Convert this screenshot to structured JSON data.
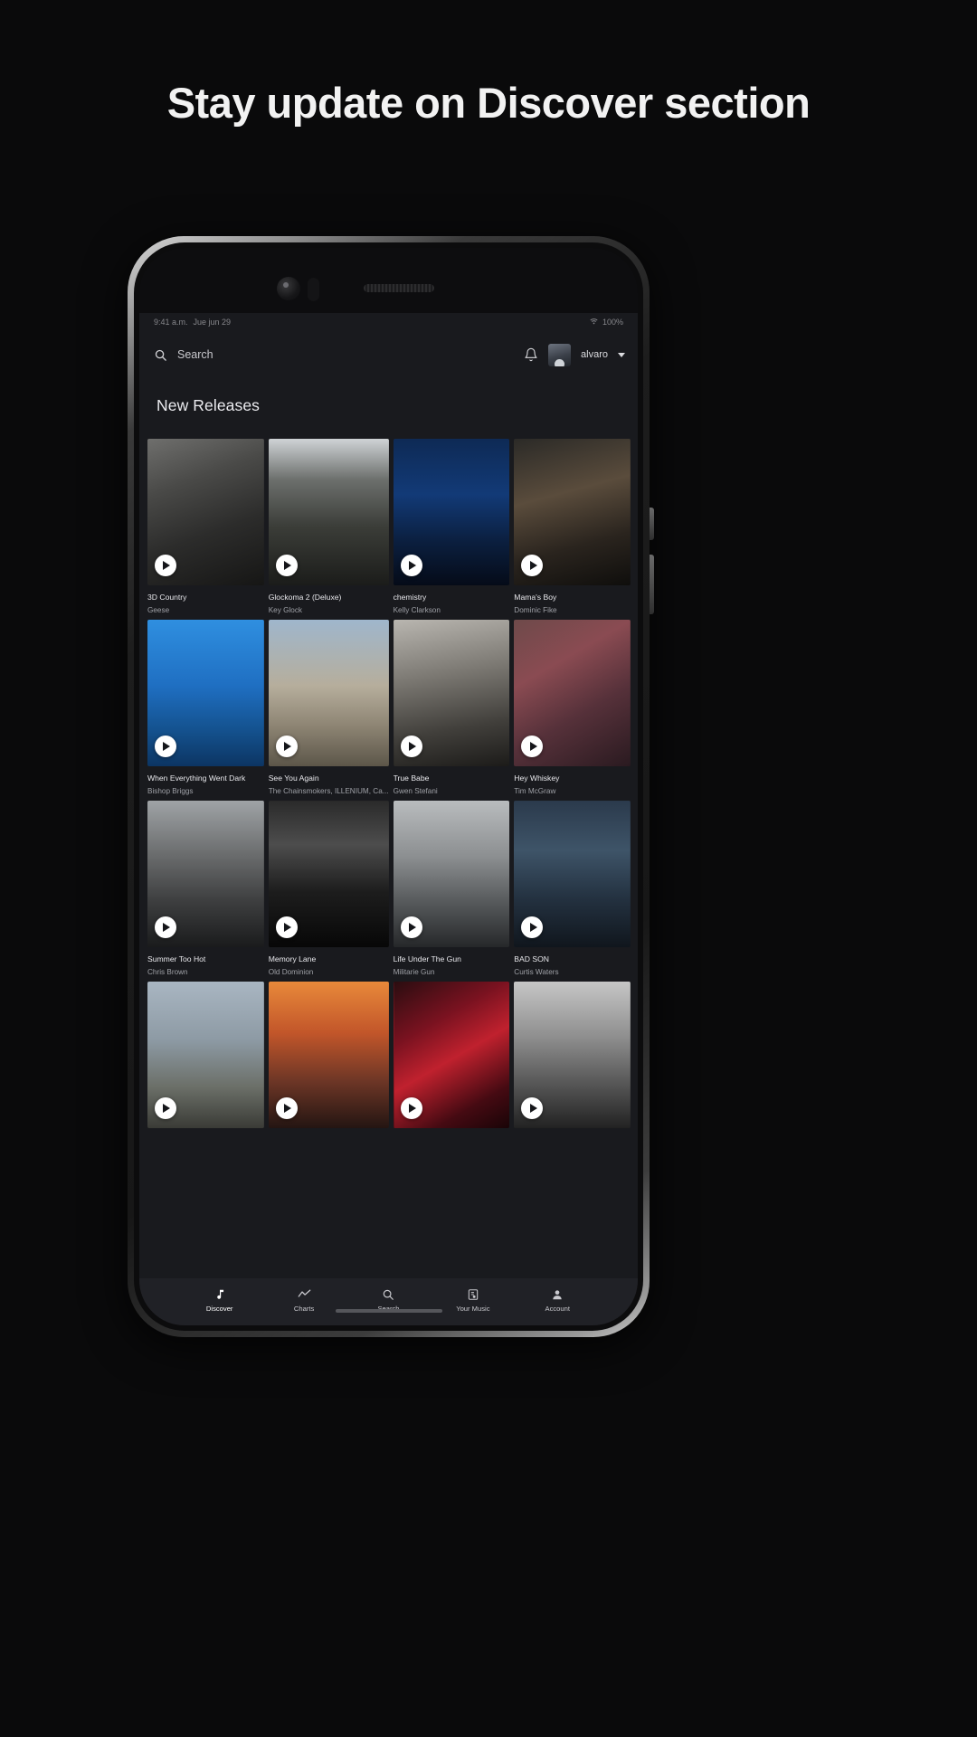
{
  "promo": {
    "headline": "Stay update on Discover section"
  },
  "phone": {
    "statusbar": {
      "time": "9:41 a.m.",
      "date": "Jue jun 29",
      "wifi": "wifi-icon",
      "battery": "100%"
    },
    "header": {
      "search_icon": "search-icon",
      "search_value": "",
      "search_placeholder": "Search",
      "bell_icon": "bell-icon",
      "avatar": "user-avatar",
      "username": "alvaro",
      "caret_icon": "chevron-down-icon"
    },
    "section": {
      "title": "New Releases"
    },
    "albums": [
      {
        "title": "3D Country",
        "artist": "Geese",
        "art": "grey-stone-building-bw"
      },
      {
        "title": "Glockoma 2 (Deluxe)",
        "artist": "Key Glock",
        "art": "tree-lined-street-bw"
      },
      {
        "title": "chemistry",
        "artist": "Kelly Clarkson",
        "art": "blue-night-harbour"
      },
      {
        "title": "Mama's Boy",
        "artist": "Dominic Fike",
        "art": "dark-alley-bench"
      },
      {
        "title": "When Everything Went Dark",
        "artist": "Bishop Briggs",
        "art": "blue-sky-tower"
      },
      {
        "title": "See You Again",
        "artist": "The Chainsmokers, ILLENIUM, Ca...",
        "art": "stone-arch-monument"
      },
      {
        "title": "True Babe",
        "artist": "Gwen Stefani",
        "art": "wooden-barrel-bw"
      },
      {
        "title": "Hey Whiskey",
        "artist": "Tim McGraw",
        "art": "red-mossy-rock"
      },
      {
        "title": "Summer Too Hot",
        "artist": "Chris Brown",
        "art": "terrace-chairs-bw"
      },
      {
        "title": "Memory Lane",
        "artist": "Old Dominion",
        "art": "dark-archway-bw"
      },
      {
        "title": "Life Under The Gun",
        "artist": "Militarie Gun",
        "art": "vintage-van-street"
      },
      {
        "title": "BAD SON",
        "artist": "Curtis Waters",
        "art": "city-street-night"
      },
      {
        "title": "",
        "artist": "",
        "art": "desert-road-clouds"
      },
      {
        "title": "",
        "artist": "",
        "art": "sunset-canal-city"
      },
      {
        "title": "",
        "artist": "",
        "art": "hot-panda-neon-sign"
      },
      {
        "title": "",
        "artist": "",
        "art": "empty-plaza-bw"
      }
    ],
    "bottom_nav": [
      {
        "label": "Discover",
        "icon": "music-note-icon",
        "active": true
      },
      {
        "label": "Charts",
        "icon": "trending-icon",
        "active": false
      },
      {
        "label": "Search",
        "icon": "search-icon",
        "active": false
      },
      {
        "label": "Your Music",
        "icon": "library-icon",
        "active": false
      },
      {
        "label": "Account",
        "icon": "person-icon",
        "active": false
      }
    ]
  },
  "colors": {
    "background": "#0a0a0b",
    "app_surface": "#191a1e",
    "nav_surface": "#202126",
    "text_primary": "#e8e8ec",
    "text_secondary": "#9ea0a6"
  }
}
